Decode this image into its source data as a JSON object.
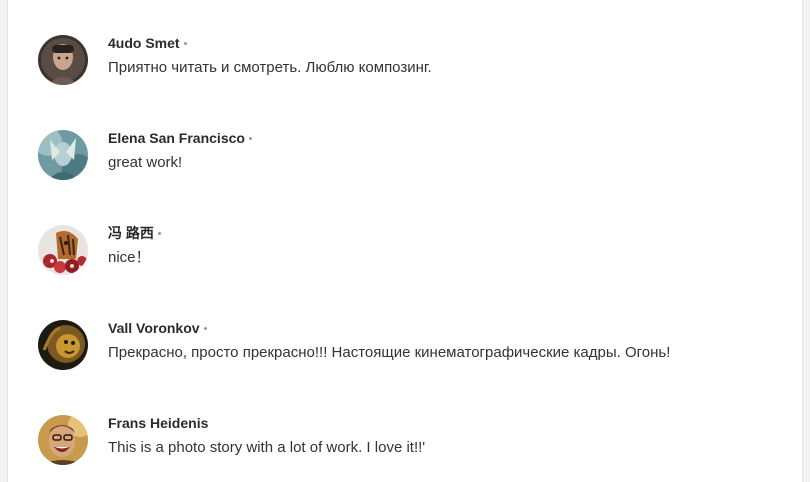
{
  "comments": [
    {
      "author": "4udo Smet",
      "text": "Приятно читать и смотреть. Люблю композинг.",
      "avatar_icon": "avatar-portrait-dark"
    },
    {
      "author": "Elena San Francisco",
      "text": "great work!",
      "avatar_icon": "avatar-teal-sculpture"
    },
    {
      "author": "冯 路西",
      "text": "nice！",
      "avatar_icon": "avatar-tiger-flowers"
    },
    {
      "author": "Vall Voronkov",
      "text": "Прекрасно, просто прекрасно!!! Настоящие кинематографические кадры. Огонь!",
      "avatar_icon": "avatar-golden-lion"
    },
    {
      "author": "Frans Heidenis",
      "text": "This is a photo story with a lot of work. I love it!!'",
      "avatar_icon": "avatar-smiling-man"
    }
  ],
  "colors": {
    "page_background": "#f2f2f2",
    "panel_background": "#ffffff",
    "author_text": "#2b2b2b",
    "comment_text": "#333333",
    "separator_dot": "#9a9a9a"
  }
}
